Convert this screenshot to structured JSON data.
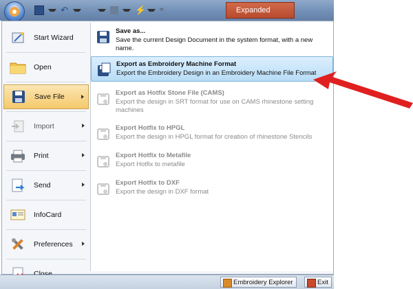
{
  "title_bar": {
    "expanded_label": "Expanded"
  },
  "left_menu": [
    {
      "label": "Start Wizard",
      "has_arrow": false,
      "disabled": false,
      "selected": false,
      "icon": "wizard-icon"
    },
    {
      "label": "Open",
      "has_arrow": false,
      "disabled": false,
      "selected": false,
      "icon": "folder-icon"
    },
    {
      "label": "Save File",
      "has_arrow": true,
      "disabled": false,
      "selected": true,
      "icon": "save-icon"
    },
    {
      "label": "Import",
      "has_arrow": true,
      "disabled": true,
      "selected": false,
      "icon": "import-icon"
    },
    {
      "label": "Print",
      "has_arrow": true,
      "disabled": false,
      "selected": false,
      "icon": "printer-icon"
    },
    {
      "label": "Send",
      "has_arrow": true,
      "disabled": false,
      "selected": false,
      "icon": "send-icon"
    },
    {
      "label": "InfoCard",
      "has_arrow": false,
      "disabled": false,
      "selected": false,
      "icon": "infocard-icon"
    },
    {
      "label": "Preferences",
      "has_arrow": true,
      "disabled": false,
      "selected": false,
      "icon": "tools-icon"
    },
    {
      "label": "Close",
      "has_arrow": false,
      "disabled": false,
      "selected": false,
      "icon": "close-document-icon"
    }
  ],
  "right_menu": [
    {
      "title": "Save as...",
      "desc": "Save the current Design Document in the system format, with a new name.",
      "disabled": false,
      "highlighted": false
    },
    {
      "title": "Export as Embroidery Machine Format",
      "desc": "Export the Embroidery Design in an Embroidery Machine File Format",
      "disabled": false,
      "highlighted": true
    },
    {
      "title": "Export as Hotfix Stone File (CAMS)",
      "desc": "Export the design in SRT format for use on CAMS rhinestone setting machines",
      "disabled": true,
      "highlighted": false
    },
    {
      "title": "Export Hotfix to HPGL",
      "desc": "Export the design in HPGL format for creation of rhinestone Stencils",
      "disabled": true,
      "highlighted": false
    },
    {
      "title": "Export Hotfix to Metafile",
      "desc": "Export Hotfix to metafile",
      "disabled": true,
      "highlighted": false
    },
    {
      "title": "Export Hotfix to DXF",
      "desc": "Export the design in DXF format",
      "disabled": true,
      "highlighted": false
    }
  ],
  "bottom_bar": {
    "explorer_label": "Embroidery Explorer",
    "exit_label": "Exit"
  },
  "colors": {
    "highlight": "#b8dcf6",
    "selected": "#f5c96b",
    "annotation_arrow": "#e02020"
  }
}
